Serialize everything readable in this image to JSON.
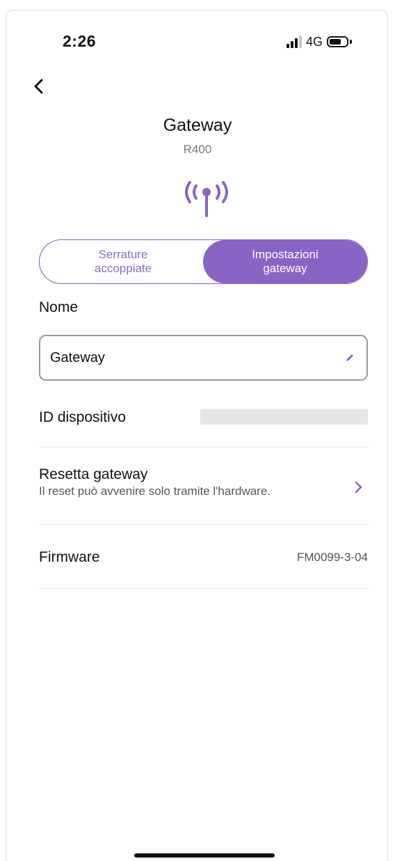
{
  "status_bar": {
    "time": "2:26",
    "network": "4G"
  },
  "header": {
    "back_icon": "chevron-left-icon",
    "title": "Gateway",
    "subtitle": "R400",
    "device_icon": "antenna-icon"
  },
  "tabs": [
    {
      "label_line1": "Serrature",
      "label_line2": "accoppiate",
      "selected": false
    },
    {
      "label_line1": "Impostazioni",
      "label_line2": "gateway",
      "selected": true
    }
  ],
  "form": {
    "name_label": "Nome",
    "name_value": "Gateway",
    "edit_icon": "pencil-icon",
    "device_id_label": "ID dispositivo"
  },
  "reset": {
    "title": "Resetta gateway",
    "subtitle": "Il reset può avvenire solo tramite l'hardware.",
    "chevron_icon": "chevron-right-icon"
  },
  "firmware": {
    "label": "Firmware",
    "value": "FM0099-3-04"
  },
  "colors": {
    "accent": "#8a63c6",
    "accent_text": "#8a6dc2"
  }
}
